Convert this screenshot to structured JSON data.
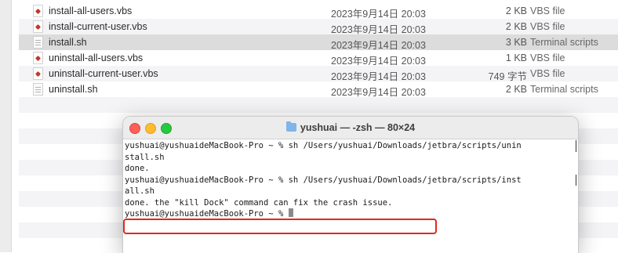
{
  "finder": {
    "rows": [
      {
        "name": "install-all-users.vbs",
        "date": "2023年9月14日 20:03",
        "size": "2 KB",
        "kind": "VBS file",
        "icon": "vbs-file-icon"
      },
      {
        "name": "install-current-user.vbs",
        "date": "2023年9月14日 20:03",
        "size": "2 KB",
        "kind": "VBS file",
        "icon": "vbs-file-icon"
      },
      {
        "name": "install.sh",
        "date": "2023年9月14日 20:03",
        "size": "3 KB",
        "kind": "Terminal scripts",
        "icon": "shell-script-icon"
      },
      {
        "name": "uninstall-all-users.vbs",
        "date": "2023年9月14日 20:03",
        "size": "1 KB",
        "kind": "VBS file",
        "icon": "vbs-file-icon"
      },
      {
        "name": "uninstall-current-user.vbs",
        "date": "2023年9月14日 20:03",
        "size": "749 字节",
        "kind": "VBS file",
        "icon": "vbs-file-icon"
      },
      {
        "name": "uninstall.sh",
        "date": "2023年9月14日 20:03",
        "size": "2 KB",
        "kind": "Terminal scripts",
        "icon": "shell-script-icon"
      }
    ]
  },
  "terminal": {
    "title_prefix": "yushuai",
    "title": " — -zsh — 80×24",
    "lines": [
      "yushuai@yushuaideMacBook-Pro ~ % sh /Users/yushuai/Downloads/jetbra/scripts/unin",
      "stall.sh",
      "done.",
      "yushuai@yushuaideMacBook-Pro ~ % sh /Users/yushuai/Downloads/jetbra/scripts/inst",
      "all.sh",
      "done. the \"kill Dock\" command can fix the crash issue.",
      "yushuai@yushuaideMacBook-Pro ~ % "
    ]
  },
  "colors": {
    "close": "#fe5f57",
    "minimize": "#febc2e",
    "zoom": "#28c840",
    "highlight": "#e0281e",
    "selected_row": "#dcdcdc"
  }
}
